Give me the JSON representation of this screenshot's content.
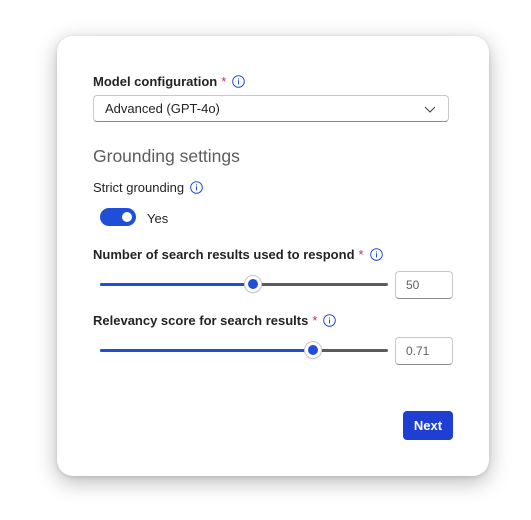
{
  "model_config": {
    "label": "Model configuration",
    "required_mark": "*",
    "selected_value": "Advanced (GPT-4o)"
  },
  "grounding": {
    "section_title": "Grounding settings",
    "strict_label": "Strict grounding",
    "toggle_on": true,
    "toggle_text": "Yes"
  },
  "search_results": {
    "label": "Number of search results used to respond",
    "required_mark": "*",
    "value": "50",
    "fill_fraction": 0.53
  },
  "relevancy": {
    "label": "Relevancy score for search results",
    "required_mark": "*",
    "value": "0.71",
    "fill_fraction": 0.74
  },
  "actions": {
    "next_label": "Next"
  },
  "colors": {
    "accent": "#1f4fd8",
    "button": "#1f3fd4",
    "required": "#c4314b",
    "track_empty": "#5c5c5c"
  },
  "icons": [
    "info-icon",
    "chevron-down-icon"
  ]
}
